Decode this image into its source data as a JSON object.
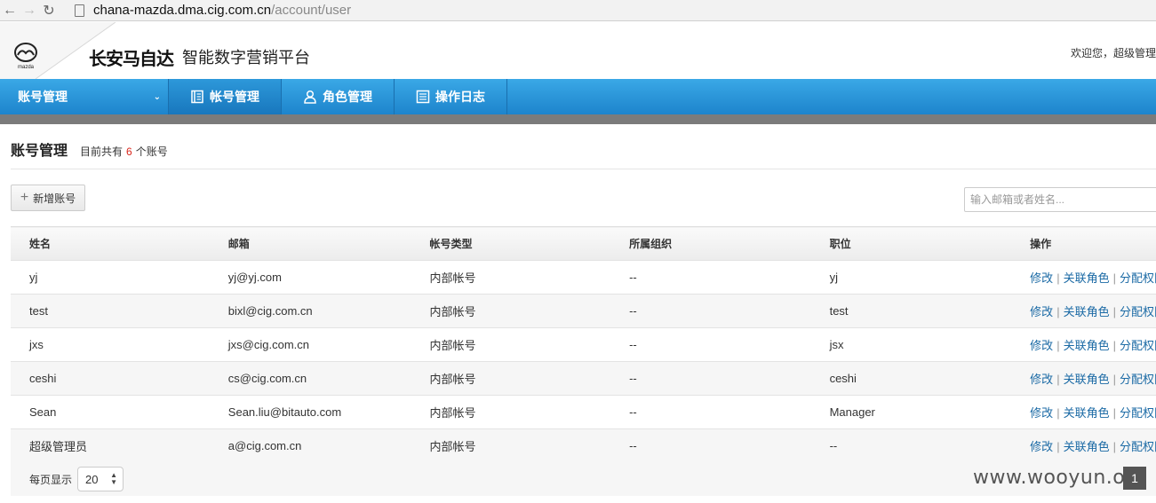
{
  "browser": {
    "url_host": "chana-mazda.dma.cig.com.cn",
    "url_path": "/account/user"
  },
  "header": {
    "logo_text": "mazda",
    "brand_cn": "长安马自达",
    "brand_sub": "智能数字营销平台",
    "welcome": "欢迎您，超级管理"
  },
  "nav": {
    "module": "账号管理",
    "items": [
      {
        "label": "帐号管理",
        "icon": "ledger-icon"
      },
      {
        "label": "角色管理",
        "icon": "user-icon"
      },
      {
        "label": "操作日志",
        "icon": "list-icon"
      }
    ],
    "accent": "#2a9ae0"
  },
  "page": {
    "title": "账号管理",
    "count_prefix": "目前共有",
    "count": "6",
    "count_suffix": "个账号",
    "add_button": "新增账号",
    "search_placeholder": "输入邮箱或者姓名..."
  },
  "table": {
    "headers": [
      "姓名",
      "邮箱",
      "帐号类型",
      "所属组织",
      "职位",
      "操作"
    ],
    "actions": [
      "修改",
      "关联角色",
      "分配权限"
    ],
    "rows": [
      {
        "name": "yj",
        "email": "yj@yj.com",
        "type": "内部帐号",
        "org": "--",
        "position": "yj"
      },
      {
        "name": "test",
        "email": "bixl@cig.com.cn",
        "type": "内部帐号",
        "org": "--",
        "position": "test"
      },
      {
        "name": "jxs",
        "email": "jxs@cig.com.cn",
        "type": "内部帐号",
        "org": "--",
        "position": "jsx"
      },
      {
        "name": "ceshi",
        "email": "cs@cig.com.cn",
        "type": "内部帐号",
        "org": "--",
        "position": "ceshi"
      },
      {
        "name": "Sean",
        "email": "Sean.liu@bitauto.com",
        "type": "内部帐号",
        "org": "--",
        "position": "Manager"
      },
      {
        "name": "超级管理员",
        "email": "a@cig.com.cn",
        "type": "内部帐号",
        "org": "--",
        "position": "--"
      }
    ]
  },
  "footer": {
    "per_page_label": "每页显示",
    "per_page_value": "20",
    "page_number": "1"
  },
  "watermark": "www.wooyun.org"
}
